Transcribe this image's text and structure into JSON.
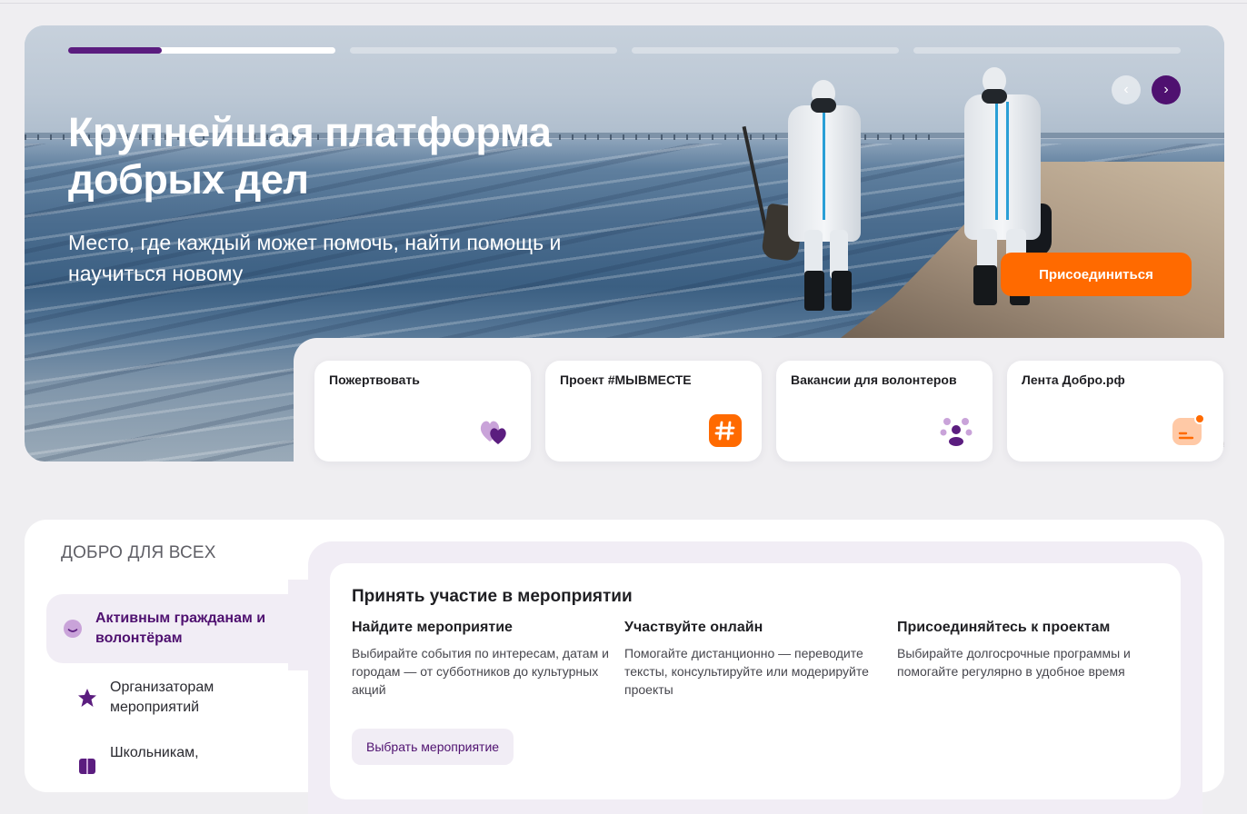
{
  "hero": {
    "title": "Крупнейшая платформа добрых дел",
    "subtitle": "Место, где каждый может помочь, найти помощь и научиться новому",
    "join_label": "Присоединиться",
    "slide_progress": 0.35,
    "slides_total": 4,
    "prev_icon": "‹",
    "next_icon": "›",
    "accent_color": "#5b1d7f",
    "cta_color": "#ff6a00"
  },
  "quick_links": [
    {
      "label": "Пожертвовать",
      "icon": "hearts-icon"
    },
    {
      "label": "Проект #МЫВМЕСТЕ",
      "icon": "hashtag-icon"
    },
    {
      "label": "Вакансии для волонтеров",
      "icon": "people-icon"
    },
    {
      "label": "Лента Добро.рф",
      "icon": "feed-icon"
    }
  ],
  "section": {
    "title": "ДОБРО ДЛЯ ВСЕХ",
    "sidebar": [
      {
        "label": "Активным гражданам и волонтёрам",
        "icon": "smile-icon",
        "active": true
      },
      {
        "label": "Организаторам мероприятий",
        "icon": "star-icon",
        "active": false
      },
      {
        "label": "Школьникам,",
        "icon": "book-icon",
        "active": false
      }
    ],
    "panel": {
      "title": "Принять участие в мероприятии",
      "columns": [
        {
          "heading": "Найдите мероприятие",
          "text": "Выбирайте события по интересам, датам и городам — от субботников до культурных акций"
        },
        {
          "heading": "Участвуйте онлайн",
          "text": "Помогайте дистанционно — переводите тексты, консультируйте или модерируйте проекты"
        },
        {
          "heading": "Присоединяйтесь к проектам",
          "text": "Выбирайте долгосрочные программы и помогайте регулярно в удобное время"
        }
      ],
      "button_label": "Выбрать мероприятие"
    }
  }
}
